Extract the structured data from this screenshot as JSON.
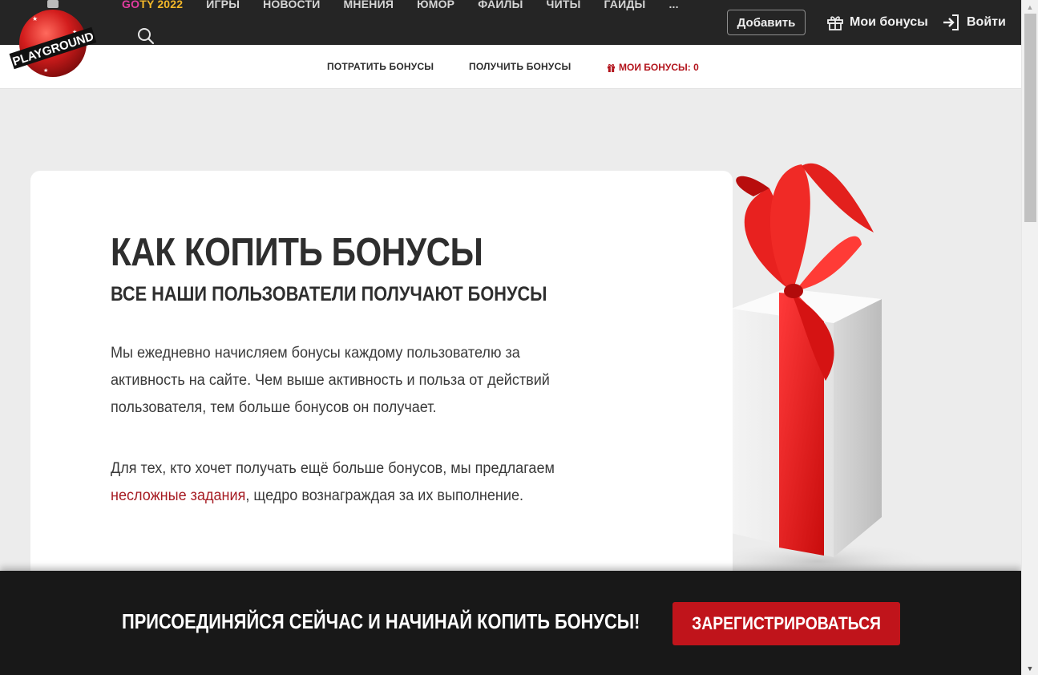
{
  "header": {
    "logo_text": "PLAYGROUND",
    "nav": [
      {
        "label_a": "GO",
        "label_b": "TY 2022",
        "special": true
      },
      {
        "label": "ИГРЫ"
      },
      {
        "label": "НОВОСТИ"
      },
      {
        "label": "МНЕНИЯ"
      },
      {
        "label": "ЮМОР"
      },
      {
        "label": "ФАЙЛЫ"
      },
      {
        "label": "ЧИТЫ"
      },
      {
        "label": "ГАЙДЫ"
      },
      {
        "label": "..."
      }
    ],
    "add_button": "Добавить",
    "my_bonuses": "Мои бонусы",
    "login": "Войти"
  },
  "subnav": {
    "spend": "ПОТРАТИТЬ БОНУСЫ",
    "get": "ПОЛУЧИТЬ БОНУСЫ",
    "mine": "МОИ БОНУСЫ: 0"
  },
  "content": {
    "title": "КАК КОПИТЬ БОНУСЫ",
    "subtitle": "ВСЕ НАШИ ПОЛЬЗОВАТЕЛИ ПОЛУЧАЮТ БОНУСЫ",
    "p1_line1": "Мы ежедневно начисляем бонусы каждому пользователю за",
    "p1_line2": "активность на сайте. Чем выше активность и польза от действий",
    "p1_line3": "пользователя, тем больше бонусов он получает.",
    "p2_line1": "Для тех, кто хочет получать ещё больше бонусов, мы предлагаем",
    "p2_link": "несложные задания",
    "p2_rest": ", щедро вознаграждая за их выполнение."
  },
  "cta": {
    "text": "ПРИСОЕДИНЯЙСЯ СЕЙЧАС И НАЧИНАЙ КОПИТЬ БОНУСЫ!",
    "button": "ЗАРЕГИСТРИРОВАТЬСЯ"
  },
  "colors": {
    "header_bg": "#252525",
    "accent_red": "#c0141b",
    "link_red": "#a61b22",
    "goty_yellow": "#f3b829",
    "goty_pink": "#e23ca0"
  },
  "icons": [
    "search-icon",
    "gift-icon",
    "login-icon",
    "gift-small-icon",
    "scroll-up-icon",
    "scroll-down-icon"
  ]
}
